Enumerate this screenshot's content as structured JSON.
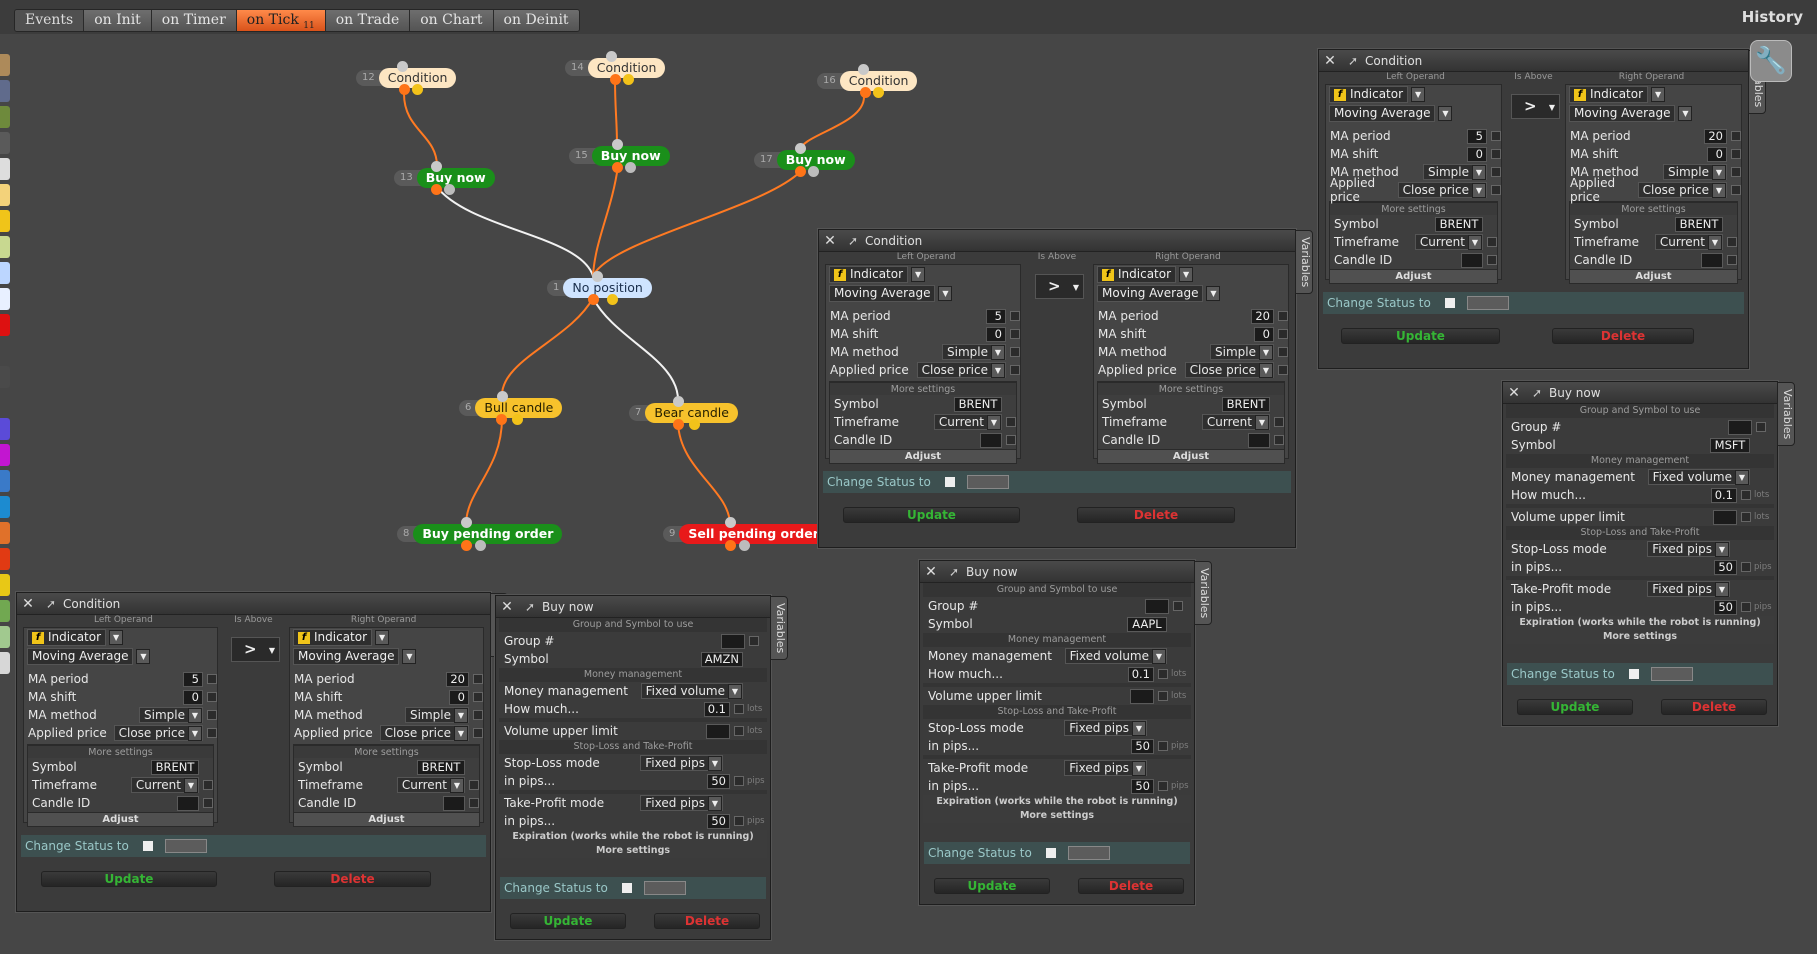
{
  "events": {
    "label": "Events",
    "tabs": [
      {
        "label": "on Init",
        "active": false
      },
      {
        "label": "on Timer",
        "active": false
      },
      {
        "label": "on Tick",
        "active": true,
        "count": "11"
      },
      {
        "label": "on Trade",
        "active": false
      },
      {
        "label": "on Chart",
        "active": false
      },
      {
        "label": "on Deinit",
        "active": false
      }
    ],
    "history": "History"
  },
  "swatch_colors": [
    "#ad8a5a",
    "#606b8c",
    "#6e8a3c",
    "#5a5a5a",
    "#dddddd",
    "#f3d27a",
    "#f0c419",
    "#c8d890",
    "#bcd6ff",
    "#e8f0ff",
    "#dd1111",
    "#464646",
    "#4a4a4a",
    "#464646",
    "#5b4bd8",
    "#c216d0",
    "#3a7ac8",
    "#1c8bd0",
    "#e0712a",
    "#e13a13",
    "#e8c816",
    "#71a851",
    "#a1c98f",
    "#d7d7d7"
  ],
  "nodes": {
    "n12": {
      "num": "12",
      "label": "Condition"
    },
    "n14": {
      "num": "14",
      "label": "Condition"
    },
    "n16": {
      "num": "16",
      "label": "Condition"
    },
    "n13": {
      "num": "13",
      "label": "Buy now"
    },
    "n15": {
      "num": "15",
      "label": "Buy now"
    },
    "n17": {
      "num": "17",
      "label": "Buy now"
    },
    "n1": {
      "num": "1",
      "label": "No position"
    },
    "n6": {
      "num": "6",
      "label": "Bull candle"
    },
    "n7": {
      "num": "7",
      "label": "Bear candle"
    },
    "n8": {
      "num": "8",
      "label": "Buy pending order"
    },
    "n9": {
      "num": "9",
      "label": "Sell pending order"
    }
  },
  "cond": {
    "title": "Condition",
    "left_operand": "Left Operand",
    "is_above": "Is Above",
    "right_operand": "Right Operand",
    "operator": ">",
    "indicator": "Indicator",
    "ma_type": "Moving Average",
    "ma_period": "MA period",
    "ma_shift": "MA shift",
    "ma_method": "MA method",
    "applied_price": "Applied price",
    "more_settings": "More settings",
    "symbol": "Symbol",
    "timeframe": "Timeframe",
    "candle_id": "Candle ID",
    "adjust": "Adjust",
    "left_period": "5",
    "right_period": "20",
    "shift": "0",
    "method": "Simple",
    "price": "Close price",
    "symbol_val": "BRENT",
    "timeframe_val": "Current",
    "change_status": "Change Status to",
    "update": "Update",
    "delete": "Delete",
    "variables": "Variables"
  },
  "buy": {
    "title": "Buy now",
    "group_and_symbol": "Group and Symbol to use",
    "group": "Group #",
    "symbol": "Symbol",
    "money_management": "Money management",
    "money_management_label": "Money management",
    "mm_value": "Fixed volume",
    "how_much": "How much...",
    "how_much_val": "0.1",
    "lots": "lots",
    "volume_upper_limit": "Volume upper limit",
    "sl_tp": "Stop-Loss and Take-Profit",
    "sl_mode": "Stop-Loss mode",
    "tp_mode": "Take-Profit mode",
    "fixed_pips": "Fixed pips",
    "in_pips": "in pips...",
    "pips_val": "50",
    "pips": "pips",
    "expiration": "Expiration (works while the robot is running)",
    "more_settings": "More settings",
    "change_status": "Change Status to",
    "update": "Update",
    "delete": "Delete",
    "variables": "Variables"
  },
  "buy_symbols": {
    "b1": "AMZN",
    "b2": "AAPL",
    "b3": "MSFT"
  }
}
